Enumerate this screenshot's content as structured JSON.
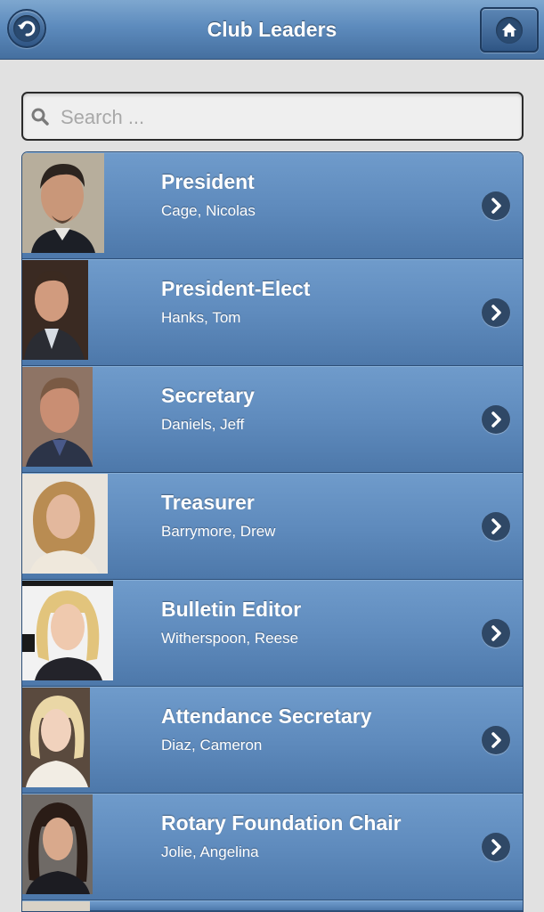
{
  "header": {
    "title": "Club Leaders",
    "back_icon": "back-arrow-icon",
    "home_icon": "home-icon"
  },
  "search": {
    "placeholder": "Search ...",
    "value": "",
    "icon": "search-icon"
  },
  "colors": {
    "header_blue": "#5d8bbd",
    "list_blue": "#5f8bbd",
    "background": "#e1e1e1",
    "text": "#ffffff"
  },
  "leaders": [
    {
      "role": "President",
      "name": "Cage, Nicolas"
    },
    {
      "role": "President-Elect",
      "name": "Hanks, Tom"
    },
    {
      "role": "Secretary",
      "name": "Daniels, Jeff"
    },
    {
      "role": "Treasurer",
      "name": "Barrymore, Drew"
    },
    {
      "role": "Bulletin Editor",
      "name": "Witherspoon, Reese"
    },
    {
      "role": "Attendance Secretary",
      "name": "Diaz, Cameron"
    },
    {
      "role": "Rotary Foundation Chair",
      "name": "Jolie, Angelina"
    }
  ]
}
